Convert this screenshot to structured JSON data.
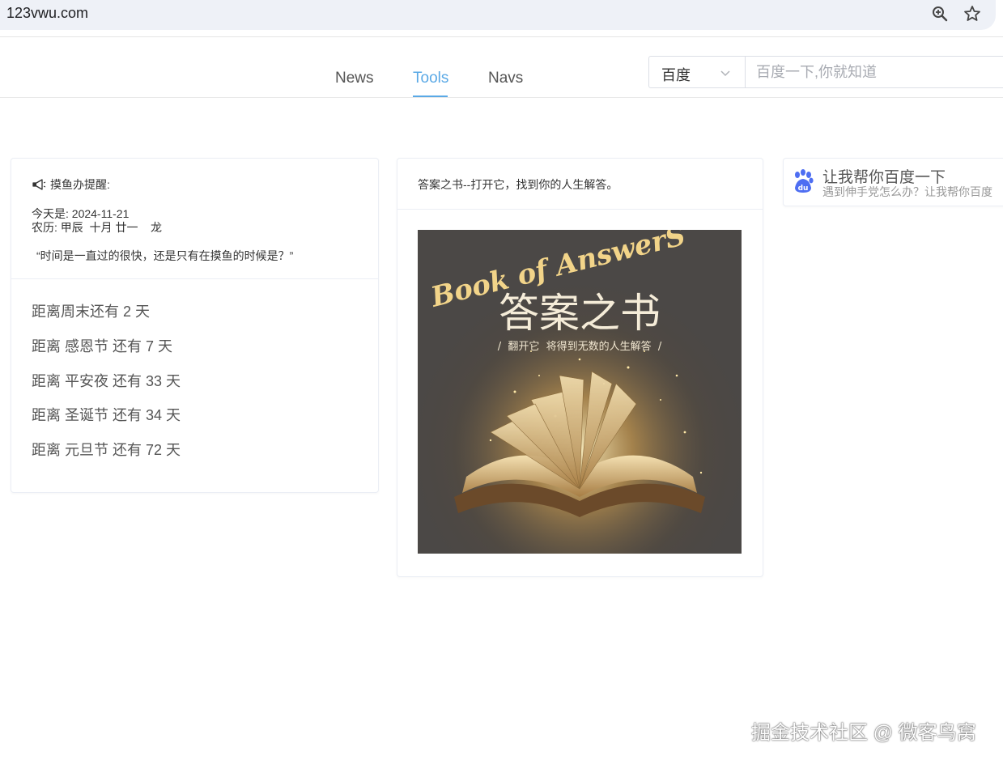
{
  "browser": {
    "url": "123vwu.com",
    "icons": [
      "zoom-icon",
      "bookmark-star-icon"
    ]
  },
  "nav": {
    "tabs": [
      {
        "label": "News",
        "active": false
      },
      {
        "label": "Tools",
        "active": true
      },
      {
        "label": "Navs",
        "active": false
      }
    ],
    "accent_color": "#5aa9e6"
  },
  "search": {
    "engine": "百度",
    "placeholder": "百度一下,你就知道",
    "value": ""
  },
  "reminder": {
    "title": "摸鱼办提醒:",
    "today": "今天是: 2024-11-21",
    "lunar": "农历: 甲辰  十月 廿一    龙",
    "quote": "“时间是一直过的很快，还是只有在摸鱼的时候是？”",
    "countdowns": [
      "距离周末还有 2 天",
      "距离 感恩节 还有 7 天",
      "距离 平安夜 还有 33 天",
      "距离 圣诞节 还有 34 天",
      "距离 元旦节 还有 72 天"
    ]
  },
  "book": {
    "header": "答案之书--打开它，找到你的人生解答。",
    "cover_title_en": "Book of AnswerS",
    "cover_title_cn": "答案之书",
    "cover_subtitle": "/  翻开它  将得到无数的人生解答  /"
  },
  "baidu": {
    "title": "让我帮你百度一下",
    "subtitle": "遇到伸手党怎么办？让我帮你百度",
    "logo_text": "du"
  },
  "watermark": "掘金技术社区 @ 微客鸟窝"
}
